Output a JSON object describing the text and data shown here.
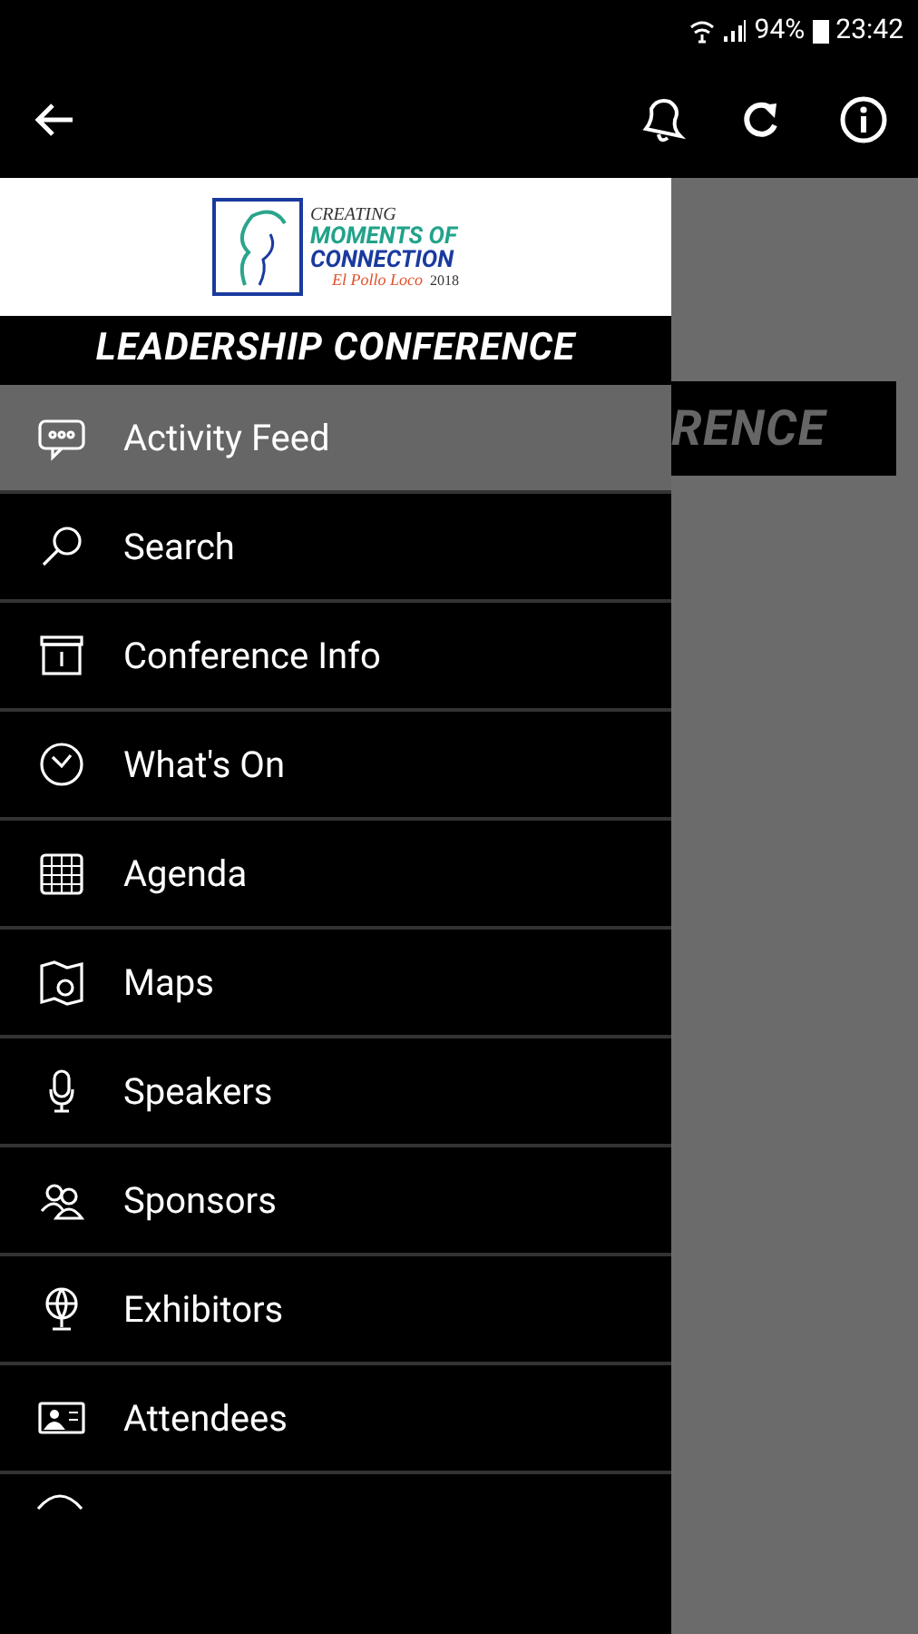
{
  "status_bar": {
    "battery": "94%",
    "time": "23:42"
  },
  "logo": {
    "line_1": "CREATING",
    "line_2": "MOMENTS OF",
    "line_3": "CONNECTION",
    "brand": "El Pollo Loco",
    "year": "2018"
  },
  "drawer_title": "LEADERSHIP CONFERENCE",
  "menu": [
    {
      "label": "Activity Feed",
      "selected": true
    },
    {
      "label": "Search",
      "selected": false
    },
    {
      "label": "Conference Info",
      "selected": false
    },
    {
      "label": "What's On",
      "selected": false
    },
    {
      "label": "Agenda",
      "selected": false
    },
    {
      "label": "Maps",
      "selected": false
    },
    {
      "label": "Speakers",
      "selected": false
    },
    {
      "label": "Sponsors",
      "selected": false
    },
    {
      "label": "Exhibitors",
      "selected": false
    },
    {
      "label": "Attendees",
      "selected": false
    }
  ],
  "background_banner": "RENCE"
}
